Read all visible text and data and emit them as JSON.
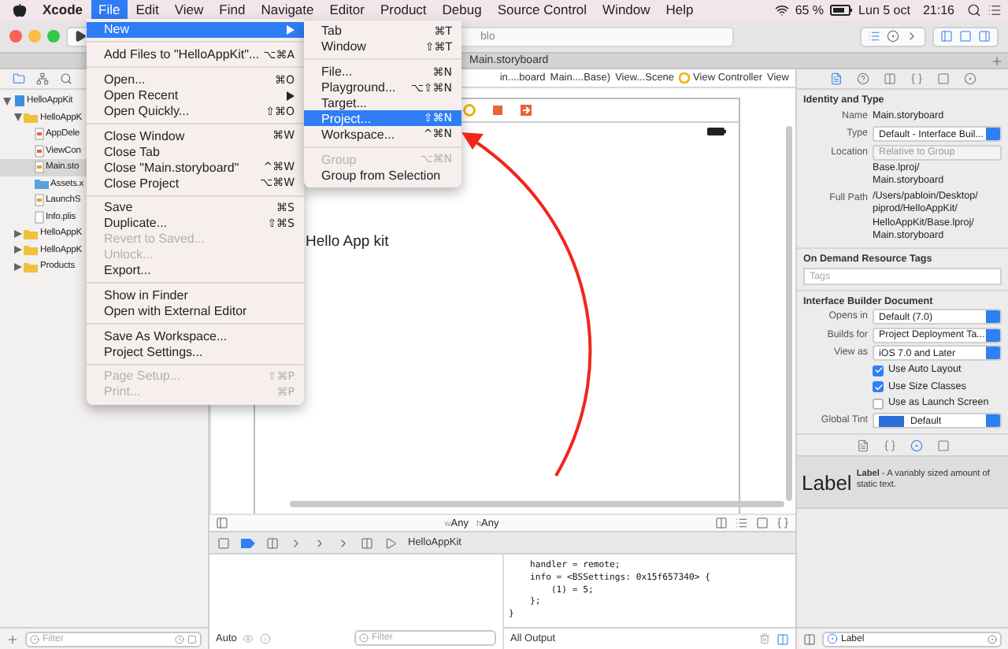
{
  "menu_bar": {
    "items": [
      {
        "label": "Xcode",
        "selected": false
      },
      {
        "label": "File",
        "selected": true
      },
      {
        "label": "Edit",
        "selected": false
      },
      {
        "label": "View",
        "selected": false
      },
      {
        "label": "Find",
        "selected": false
      },
      {
        "label": "Navigate",
        "selected": false
      },
      {
        "label": "Editor",
        "selected": false
      },
      {
        "label": "Product",
        "selected": false
      },
      {
        "label": "Debug",
        "selected": false
      },
      {
        "label": "Source Control",
        "selected": false
      },
      {
        "label": "Window",
        "selected": false
      },
      {
        "label": "Help",
        "selected": false
      }
    ],
    "battery": "65 %",
    "date": "Lun 5 oct",
    "time": "21:16"
  },
  "toolbar": {
    "activity": "blo"
  },
  "editor_tab": {
    "label": "Main.storyboard"
  },
  "file_menu": [
    {
      "kind": "item",
      "label": "New",
      "submenu": true,
      "selected": true,
      "disabled": false
    },
    {
      "kind": "separator"
    },
    {
      "kind": "item",
      "label": "Add Files to \"HelloAppKit\"...",
      "shortcut": "⌥⌘A",
      "submenu": false,
      "selected": false,
      "disabled": false
    },
    {
      "kind": "separator"
    },
    {
      "kind": "item",
      "label": "Open...",
      "shortcut": "⌘O",
      "submenu": false,
      "selected": false,
      "disabled": false
    },
    {
      "kind": "item",
      "label": "Open Recent",
      "submenu": true,
      "selected": false,
      "disabled": false
    },
    {
      "kind": "item",
      "label": "Open Quickly...",
      "shortcut": "⇧⌘O",
      "submenu": false,
      "selected": false,
      "disabled": false
    },
    {
      "kind": "separator"
    },
    {
      "kind": "item",
      "label": "Close Window",
      "shortcut": "⌘W",
      "submenu": false,
      "selected": false,
      "disabled": false
    },
    {
      "kind": "item",
      "label": "Close Tab",
      "submenu": false,
      "selected": false,
      "disabled": false
    },
    {
      "kind": "item",
      "label": "Close \"Main.storyboard\"",
      "shortcut": "^⌘W",
      "submenu": false,
      "selected": false,
      "disabled": false
    },
    {
      "kind": "item",
      "label": "Close Project",
      "shortcut": "⌥⌘W",
      "submenu": false,
      "selected": false,
      "disabled": false
    },
    {
      "kind": "separator"
    },
    {
      "kind": "item",
      "label": "Save",
      "shortcut": "⌘S",
      "submenu": false,
      "selected": false,
      "disabled": false
    },
    {
      "kind": "item",
      "label": "Duplicate...",
      "shortcut": "⇧⌘S",
      "submenu": false,
      "selected": false,
      "disabled": false
    },
    {
      "kind": "item",
      "label": "Revert to Saved...",
      "submenu": false,
      "selected": false,
      "disabled": true
    },
    {
      "kind": "item",
      "label": "Unlock...",
      "submenu": false,
      "selected": false,
      "disabled": true
    },
    {
      "kind": "item",
      "label": "Export...",
      "submenu": false,
      "selected": false,
      "disabled": false
    },
    {
      "kind": "separator"
    },
    {
      "kind": "item",
      "label": "Show in Finder",
      "submenu": false,
      "selected": false,
      "disabled": false
    },
    {
      "kind": "item",
      "label": "Open with External Editor",
      "submenu": false,
      "selected": false,
      "disabled": false
    },
    {
      "kind": "separator"
    },
    {
      "kind": "item",
      "label": "Save As Workspace...",
      "submenu": false,
      "selected": false,
      "disabled": false
    },
    {
      "kind": "item",
      "label": "Project Settings...",
      "submenu": false,
      "selected": false,
      "disabled": false
    },
    {
      "kind": "separator"
    },
    {
      "kind": "item",
      "label": "Page Setup...",
      "shortcut": "⇧⌘P",
      "submenu": false,
      "selected": false,
      "disabled": true
    },
    {
      "kind": "item",
      "label": "Print...",
      "shortcut": "⌘P",
      "submenu": false,
      "selected": false,
      "disabled": true
    }
  ],
  "new_submenu": [
    {
      "kind": "item",
      "label": "Tab",
      "shortcut": "⌘T",
      "submenu": false,
      "selected": false,
      "disabled": false
    },
    {
      "kind": "item",
      "label": "Window",
      "shortcut": "⇧⌘T",
      "submenu": false,
      "selected": false,
      "disabled": false
    },
    {
      "kind": "separator"
    },
    {
      "kind": "item",
      "label": "File...",
      "shortcut": "⌘N",
      "submenu": false,
      "selected": false,
      "disabled": false
    },
    {
      "kind": "item",
      "label": "Playground...",
      "shortcut": "⌥⇧⌘N",
      "submenu": false,
      "selected": false,
      "disabled": false
    },
    {
      "kind": "item",
      "label": "Target...",
      "submenu": false,
      "selected": false,
      "disabled": false
    },
    {
      "kind": "item",
      "label": "Project...",
      "shortcut": "⇧⌘N",
      "submenu": false,
      "selected": true,
      "disabled": false
    },
    {
      "kind": "item",
      "label": "Workspace...",
      "shortcut": "^⌘N",
      "submenu": false,
      "selected": false,
      "disabled": false
    },
    {
      "kind": "separator"
    },
    {
      "kind": "item",
      "label": "Group",
      "shortcut": "⌥⌘N",
      "submenu": false,
      "selected": false,
      "disabled": true
    },
    {
      "kind": "item",
      "label": "Group from Selection",
      "submenu": false,
      "selected": false,
      "disabled": false
    }
  ],
  "navigator": {
    "tree": [
      {
        "label": "HelloAppKit",
        "kind": "project",
        "selected": false,
        "expanded": true,
        "children": [
          {
            "label": "HelloAppK",
            "kind": "folder",
            "selected": false,
            "expanded": true,
            "children": [
              {
                "label": "AppDele",
                "kind": "swift",
                "selected": false
              },
              {
                "label": "ViewCon",
                "kind": "swift",
                "selected": false
              },
              {
                "label": "Main.sto",
                "kind": "storyboard",
                "selected": true
              },
              {
                "label": "Assets.x",
                "kind": "assets",
                "selected": false
              },
              {
                "label": "LaunchS",
                "kind": "storyboard",
                "selected": false
              },
              {
                "label": "Info.plis",
                "kind": "plist",
                "selected": false
              }
            ]
          },
          {
            "label": "HelloAppK",
            "kind": "folder",
            "selected": false,
            "expanded": false
          },
          {
            "label": "HelloAppK",
            "kind": "folder",
            "selected": false,
            "expanded": false
          },
          {
            "label": "Products",
            "kind": "folder",
            "selected": false,
            "expanded": false
          }
        ]
      }
    ],
    "filter": {
      "placeholder": "Filter"
    }
  },
  "jump_bar": [
    "in....board",
    "Main....Base)",
    "View...Scene",
    "View Controller",
    "View"
  ],
  "canvas": {
    "label_text": "Hello App kit",
    "size_class": [
      {
        "axis": "w",
        "value": "Any"
      },
      {
        "axis": "h",
        "value": "Any"
      }
    ]
  },
  "debug": {
    "target": "HelloAppKit",
    "scope": "Auto",
    "variables_filter": {
      "placeholder": "Filter"
    },
    "console_lines": [
      "    handler = remote;",
      "    info = <BSSettings: 0x15f657340> {",
      "        (1) = 5;",
      "    };",
      "}"
    ],
    "output": "All Output"
  },
  "inspector": {
    "tabs": [
      {
        "selected": true
      },
      {
        "selected": false
      },
      {
        "selected": false
      },
      {
        "selected": false
      },
      {
        "selected": false
      },
      {
        "selected": false
      }
    ],
    "identity": {
      "title": "Identity and Type",
      "name_label": "Name",
      "name": "Main.storyboard",
      "type_label": "Type",
      "type": "Default - Interface Buil...",
      "location_label": "Location",
      "location": "Relative to Group",
      "path_lines": [
        "Base.lproj/",
        "Main.storyboard"
      ],
      "full_path_label": "Full Path",
      "full_path_lines": [
        "/Users/pabloin/Desktop/",
        "piprod/HelloAppKit/",
        "HelloAppKit/Base.lproj/",
        "Main.storyboard"
      ]
    },
    "tags": {
      "title": "On Demand Resource Tags",
      "placeholder": "Tags"
    },
    "ib_document": {
      "title": "Interface Builder Document",
      "selects": [
        {
          "label": "Opens in",
          "value": "Default (7.0)"
        },
        {
          "label": "Builds for",
          "value": "Project Deployment Ta..."
        },
        {
          "label": "View as",
          "value": "iOS 7.0 and Later"
        }
      ],
      "checkboxes": [
        {
          "label": "Use Auto Layout",
          "checked": true
        },
        {
          "label": "Use Size Classes",
          "checked": true
        },
        {
          "label": "Use as Launch Screen",
          "checked": false
        }
      ],
      "tint_label": "Global Tint",
      "tint_value": "Default"
    }
  },
  "library": {
    "tabs": [
      {
        "selected": false
      },
      {
        "selected": false
      },
      {
        "selected": true
      },
      {
        "selected": false
      }
    ],
    "items": [
      {
        "preview": "Label",
        "description": "**Label** - A variably sized amount of static text."
      }
    ],
    "filter_value": "Label"
  }
}
